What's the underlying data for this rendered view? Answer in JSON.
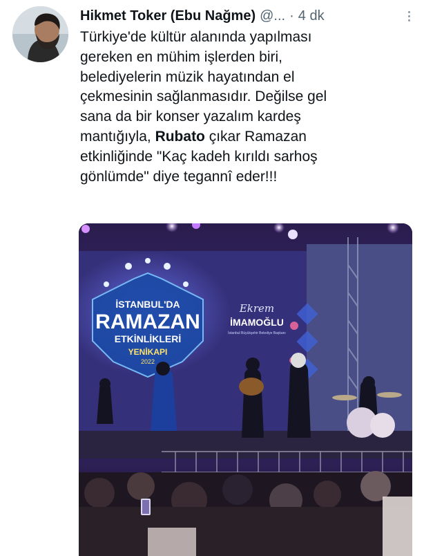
{
  "tweet": {
    "author_name": "Hikmet Toker (Ebu Nağme)",
    "handle": "@...",
    "separator": "·",
    "time": "4 dk",
    "text_lines": [
      "Türkiye'de kültür alanında yapılması",
      "gereken en mühim işlerden biri,",
      "belediyelerin müzik hayatından el",
      "çekmesinin sağlanmasıdır. Değilse gel",
      "sana da bir konser  yazalım kardeş",
      "mantığıyla, ",
      "Rubato",
      " çıkar Ramazan",
      "etkinliğinde \"Kaç kadeh kırıldı sarhoş",
      "gönlümde\" diye tegannî eder!!!"
    ]
  },
  "media": {
    "banner_line1": "İSTANBUL'DA",
    "banner_line2": "RAMAZAN",
    "banner_line3": "ETKİNLİKLERİ",
    "banner_line4": "YENİKAPI",
    "banner_year": "2022",
    "sponsor_script": "Ekrem",
    "sponsor_name": "İMAMOĞLU",
    "sponsor_sub": "İstanbul Büyükşehir Belediye Başkanı"
  },
  "icons": {
    "more": "more-options-icon",
    "avatar": "user-avatar"
  }
}
